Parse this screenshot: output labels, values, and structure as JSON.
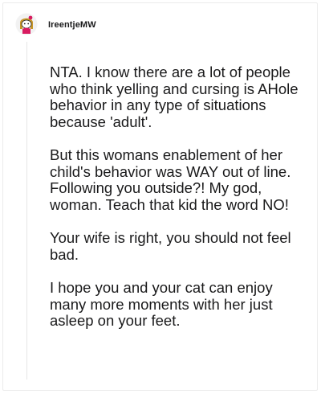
{
  "comment": {
    "username": "IreentjeMW",
    "avatar_icon": "snoo-avatar-icon",
    "paragraphs": [
      "NTA. I know there are a lot of people who think yelling and cursing is AHole behavior in any type of situations because 'adult'.",
      "But this womans enablement of her child's behavior was WAY out of line. Following you outside?! My god, woman. Teach that kid the word NO!",
      "Your wife is right, you should not feel bad.",
      "I hope you and your cat can enjoy many more moments with her just asleep on your feet."
    ]
  },
  "colors": {
    "text": "#1a1a1b",
    "avatar_hair": "#c7962a",
    "avatar_accent": "#d81b60",
    "thread_line": "#e6e6e6"
  }
}
